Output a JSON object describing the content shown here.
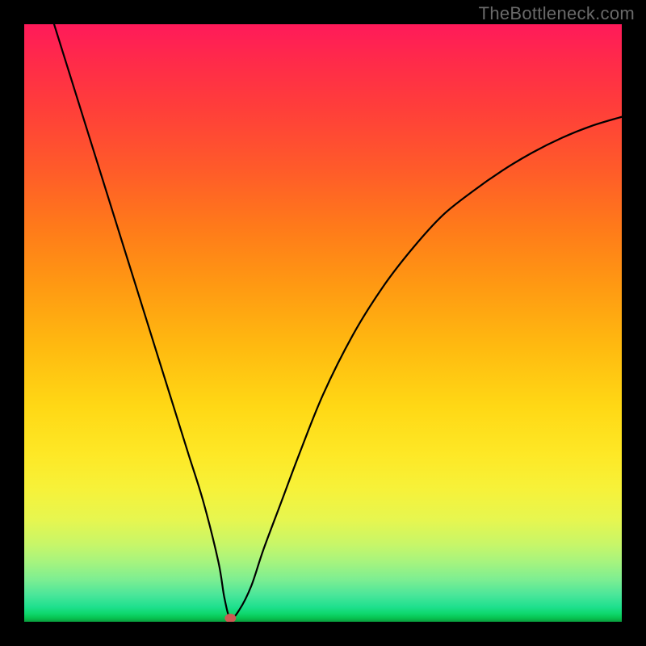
{
  "watermark": "TheBottleneck.com",
  "colors": {
    "background": "#000000",
    "curve": "#000000",
    "marker": "#cc5a52"
  },
  "chart_data": {
    "type": "line",
    "title": "",
    "xlabel": "",
    "ylabel": "",
    "xlim": [
      0,
      100
    ],
    "ylim": [
      0,
      100
    ],
    "grid": false,
    "legend": false,
    "series": [
      {
        "name": "bottleneck-curve",
        "x": [
          5,
          7.5,
          10,
          12.5,
          15,
          17.5,
          20,
          22.5,
          25,
          27.5,
          30,
          32.5,
          33.5,
          34.5,
          36,
          38,
          40,
          43,
          46,
          50,
          55,
          60,
          65,
          70,
          75,
          80,
          85,
          90,
          95,
          100
        ],
        "values": [
          100,
          92,
          84,
          76,
          68,
          60,
          52,
          44,
          36,
          28,
          20,
          10,
          4,
          0.6,
          2,
          6,
          12,
          20,
          28,
          38,
          48,
          56,
          62.5,
          68,
          72,
          75.5,
          78.5,
          81,
          83,
          84.5
        ]
      }
    ],
    "marker": {
      "x": 34.5,
      "y": 0.6
    }
  }
}
